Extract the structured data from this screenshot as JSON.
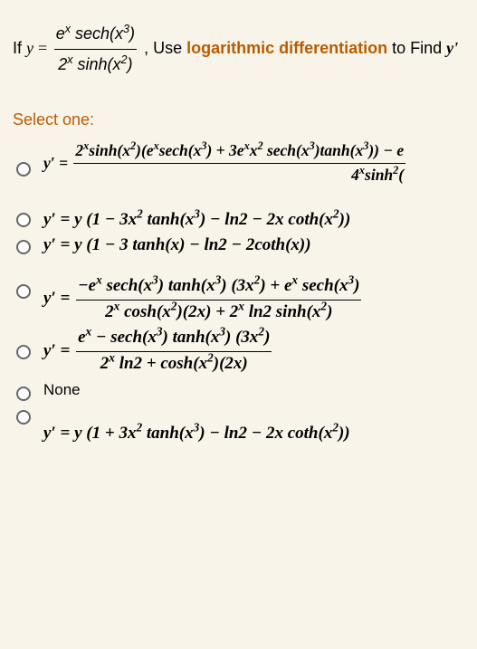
{
  "question": {
    "prefix": "If ",
    "useText": ", Use",
    "keyword": "logarithmic differentiation",
    "toFind": " to Find ",
    "yprime": "y'",
    "equation": {
      "lhs": "y =",
      "numerator_html": "e<sup>x</sup> sech(x<sup>3</sup>)",
      "denominator_html": "2<sup>x</sup> sinh(x<sup>2</sup>)"
    }
  },
  "selectOne": "Select one:",
  "options": {
    "opt1": {
      "lhs": "y′ =",
      "num": "2<sup>x</sup>sinh(x<sup>2</sup>)(e<sup>x</sup>sech(x<sup>3</sup>) + 3e<sup>x</sup>x<sup>2</sup> sech(x<sup>3</sup>)tanh(x<sup>3</sup>)) − e",
      "den_right": "4<sup>x</sup>sinh<sup>2</sup>("
    },
    "opt2": "y′ = y (1 − 3x<sup>2</sup> tanh(x<sup>3</sup>) − ln2 − 2x coth(x<sup>2</sup>))",
    "opt3": "y′ = y (1 − 3 tanh(x) − ln2 − 2coth(x))",
    "opt4": {
      "lhs": "y′ =",
      "num": "−e<sup>x</sup> sech(x<sup>3</sup>) tanh(x<sup>3</sup>) (3x<sup>2</sup>) + e<sup>x</sup> sech(x<sup>3</sup>)",
      "den": "2<sup>x</sup> cosh(x<sup>2</sup>)(2x) + 2<sup>x</sup> ln2 sinh(x<sup>2</sup>)"
    },
    "opt5": {
      "lhs": "y′ =",
      "num": "e<sup>x</sup> − sech(x<sup>3</sup>) tanh(x<sup>3</sup>) (3x<sup>2</sup>)",
      "den": "2<sup>x</sup> ln2 + cosh(x<sup>2</sup>)(2x)"
    },
    "opt6": "None",
    "opt7": "y′ = y (1 + 3x<sup>2</sup> tanh(x<sup>3</sup>) − ln2 − 2x coth(x<sup>2</sup>))"
  }
}
